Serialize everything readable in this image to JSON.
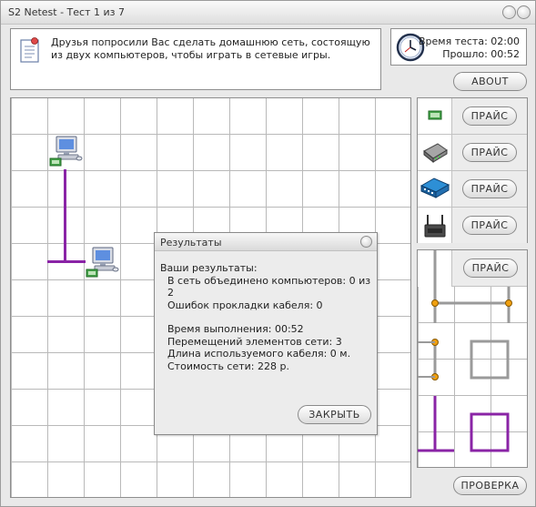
{
  "window": {
    "title": "S2 Netest - Тест 1 из 7"
  },
  "task": {
    "text": "Друзья попросили Вас сделать домашнюю сеть, состоящую из двух компьютеров, чтобы играть в сетевые игры."
  },
  "timer": {
    "time_label": "Время теста:",
    "time_value": "02:00",
    "elapsed_label": "Прошло:",
    "elapsed_value": "00:52"
  },
  "buttons": {
    "about": "ABOUT",
    "check": "ПРОВЕРКА",
    "close": "ЗАКРЫТЬ"
  },
  "palette": {
    "items": [
      {
        "icon": "network-card-icon",
        "button": "ПРАЙС"
      },
      {
        "icon": "modem-icon",
        "button": "ПРАЙС"
      },
      {
        "icon": "switch-icon",
        "button": "ПРАЙС"
      },
      {
        "icon": "wifi-router-icon",
        "button": "ПРАЙС"
      }
    ],
    "cable_button": "ПРАЙС"
  },
  "results": {
    "title": "Результаты",
    "heading": "Ваши результаты:",
    "line1": "В сеть объединено компьютеров: 0 из 2",
    "line2": "Ошибок прокладки кабеля: 0",
    "line3": "Время выполнения: 00:52",
    "line4": "Перемещений элементов сети: 3",
    "line5": "Длина используемого кабеля: 0 м.",
    "line6": "Стоимость сети: 228 р."
  },
  "colors": {
    "cable": "#8a24a6",
    "grid": "#b9b9b9",
    "connector": "#f0a010"
  }
}
